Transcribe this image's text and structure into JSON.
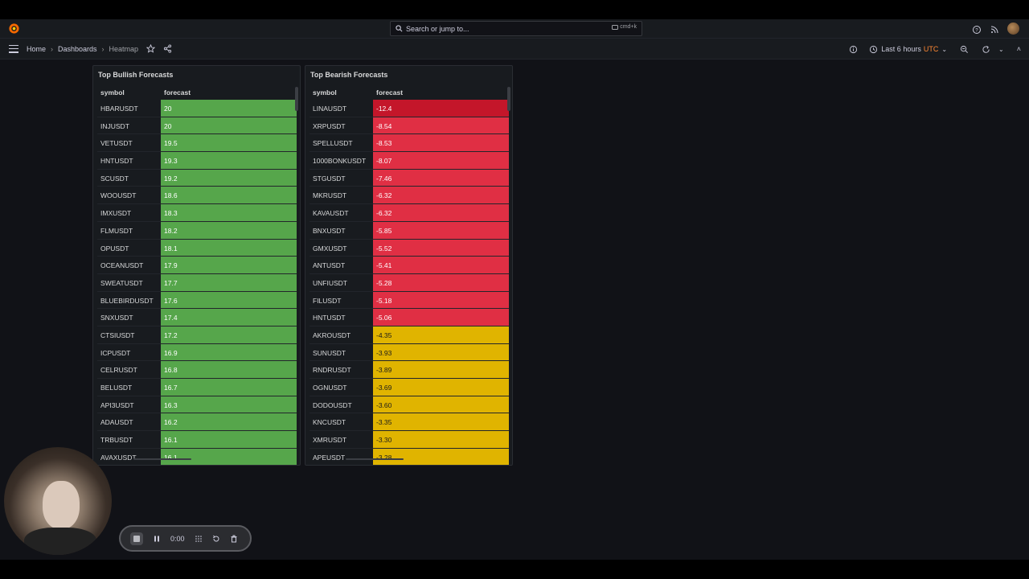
{
  "search": {
    "placeholder": "Search or jump to...",
    "shortcut": "cmd+k"
  },
  "breadcrumb": {
    "home": "Home",
    "dashboards": "Dashboards",
    "current": "Heatmap"
  },
  "time_picker": {
    "label": "Last 6 hours",
    "timezone": "UTC"
  },
  "recorder": {
    "time": "0:00"
  },
  "colors": {
    "green": "#56a64b",
    "red_dark": "#c4162a",
    "red": "#e02f44",
    "yellow": "#e0b400"
  },
  "bullish": {
    "title": "Top Bullish Forecasts",
    "col_symbol": "symbol",
    "col_forecast": "forecast",
    "rows": [
      {
        "symbol": "HBARUSDT",
        "forecast": "20",
        "color": "#56a64b"
      },
      {
        "symbol": "INJUSDT",
        "forecast": "20",
        "color": "#56a64b"
      },
      {
        "symbol": "VETUSDT",
        "forecast": "19.5",
        "color": "#56a64b"
      },
      {
        "symbol": "HNTUSDT",
        "forecast": "19.3",
        "color": "#56a64b"
      },
      {
        "symbol": "SCUSDT",
        "forecast": "19.2",
        "color": "#56a64b"
      },
      {
        "symbol": "WOOUSDT",
        "forecast": "18.6",
        "color": "#56a64b"
      },
      {
        "symbol": "IMXUSDT",
        "forecast": "18.3",
        "color": "#56a64b"
      },
      {
        "symbol": "FLMUSDT",
        "forecast": "18.2",
        "color": "#56a64b"
      },
      {
        "symbol": "OPUSDT",
        "forecast": "18.1",
        "color": "#56a64b"
      },
      {
        "symbol": "OCEANUSDT",
        "forecast": "17.9",
        "color": "#56a64b"
      },
      {
        "symbol": "SWEATUSDT",
        "forecast": "17.7",
        "color": "#56a64b"
      },
      {
        "symbol": "BLUEBIRDUSDT",
        "forecast": "17.6",
        "color": "#56a64b"
      },
      {
        "symbol": "SNXUSDT",
        "forecast": "17.4",
        "color": "#56a64b"
      },
      {
        "symbol": "CTSIUSDT",
        "forecast": "17.2",
        "color": "#56a64b"
      },
      {
        "symbol": "ICPUSDT",
        "forecast": "16.9",
        "color": "#56a64b"
      },
      {
        "symbol": "CELRUSDT",
        "forecast": "16.8",
        "color": "#56a64b"
      },
      {
        "symbol": "BELUSDT",
        "forecast": "16.7",
        "color": "#56a64b"
      },
      {
        "symbol": "API3USDT",
        "forecast": "16.3",
        "color": "#56a64b"
      },
      {
        "symbol": "ADAUSDT",
        "forecast": "16.2",
        "color": "#56a64b"
      },
      {
        "symbol": "TRBUSDT",
        "forecast": "16.1",
        "color": "#56a64b"
      },
      {
        "symbol": "AVAXUSDT",
        "forecast": "16.1",
        "color": "#56a64b"
      }
    ]
  },
  "bearish": {
    "title": "Top Bearish Forecasts",
    "col_symbol": "symbol",
    "col_forecast": "forecast",
    "rows": [
      {
        "symbol": "LINAUSDT",
        "forecast": "-12.4",
        "color": "#c4162a"
      },
      {
        "symbol": "XRPUSDT",
        "forecast": "-8.54",
        "color": "#e02f44"
      },
      {
        "symbol": "SPELLUSDT",
        "forecast": "-8.53",
        "color": "#e02f44"
      },
      {
        "symbol": "1000BONKUSDT",
        "forecast": "-8.07",
        "color": "#e02f44"
      },
      {
        "symbol": "STGUSDT",
        "forecast": "-7.46",
        "color": "#e02f44"
      },
      {
        "symbol": "MKRUSDT",
        "forecast": "-6.32",
        "color": "#e02f44"
      },
      {
        "symbol": "KAVAUSDT",
        "forecast": "-6.32",
        "color": "#e02f44"
      },
      {
        "symbol": "BNXUSDT",
        "forecast": "-5.85",
        "color": "#e02f44"
      },
      {
        "symbol": "GMXUSDT",
        "forecast": "-5.52",
        "color": "#e02f44"
      },
      {
        "symbol": "ANTUSDT",
        "forecast": "-5.41",
        "color": "#e02f44"
      },
      {
        "symbol": "UNFIUSDT",
        "forecast": "-5.28",
        "color": "#e02f44"
      },
      {
        "symbol": "FILUSDT",
        "forecast": "-5.18",
        "color": "#e02f44"
      },
      {
        "symbol": "HNTUSDT",
        "forecast": "-5.06",
        "color": "#e02f44"
      },
      {
        "symbol": "AKROUSDT",
        "forecast": "-4.35",
        "color": "#e0b400"
      },
      {
        "symbol": "SUNUSDT",
        "forecast": "-3.93",
        "color": "#e0b400"
      },
      {
        "symbol": "RNDRUSDT",
        "forecast": "-3.89",
        "color": "#e0b400"
      },
      {
        "symbol": "OGNUSDT",
        "forecast": "-3.69",
        "color": "#e0b400"
      },
      {
        "symbol": "DODOUSDT",
        "forecast": "-3.60",
        "color": "#e0b400"
      },
      {
        "symbol": "KNCUSDT",
        "forecast": "-3.35",
        "color": "#e0b400"
      },
      {
        "symbol": "XMRUSDT",
        "forecast": "-3.30",
        "color": "#e0b400"
      },
      {
        "symbol": "APEUSDT",
        "forecast": "-3.28",
        "color": "#e0b400"
      }
    ]
  }
}
